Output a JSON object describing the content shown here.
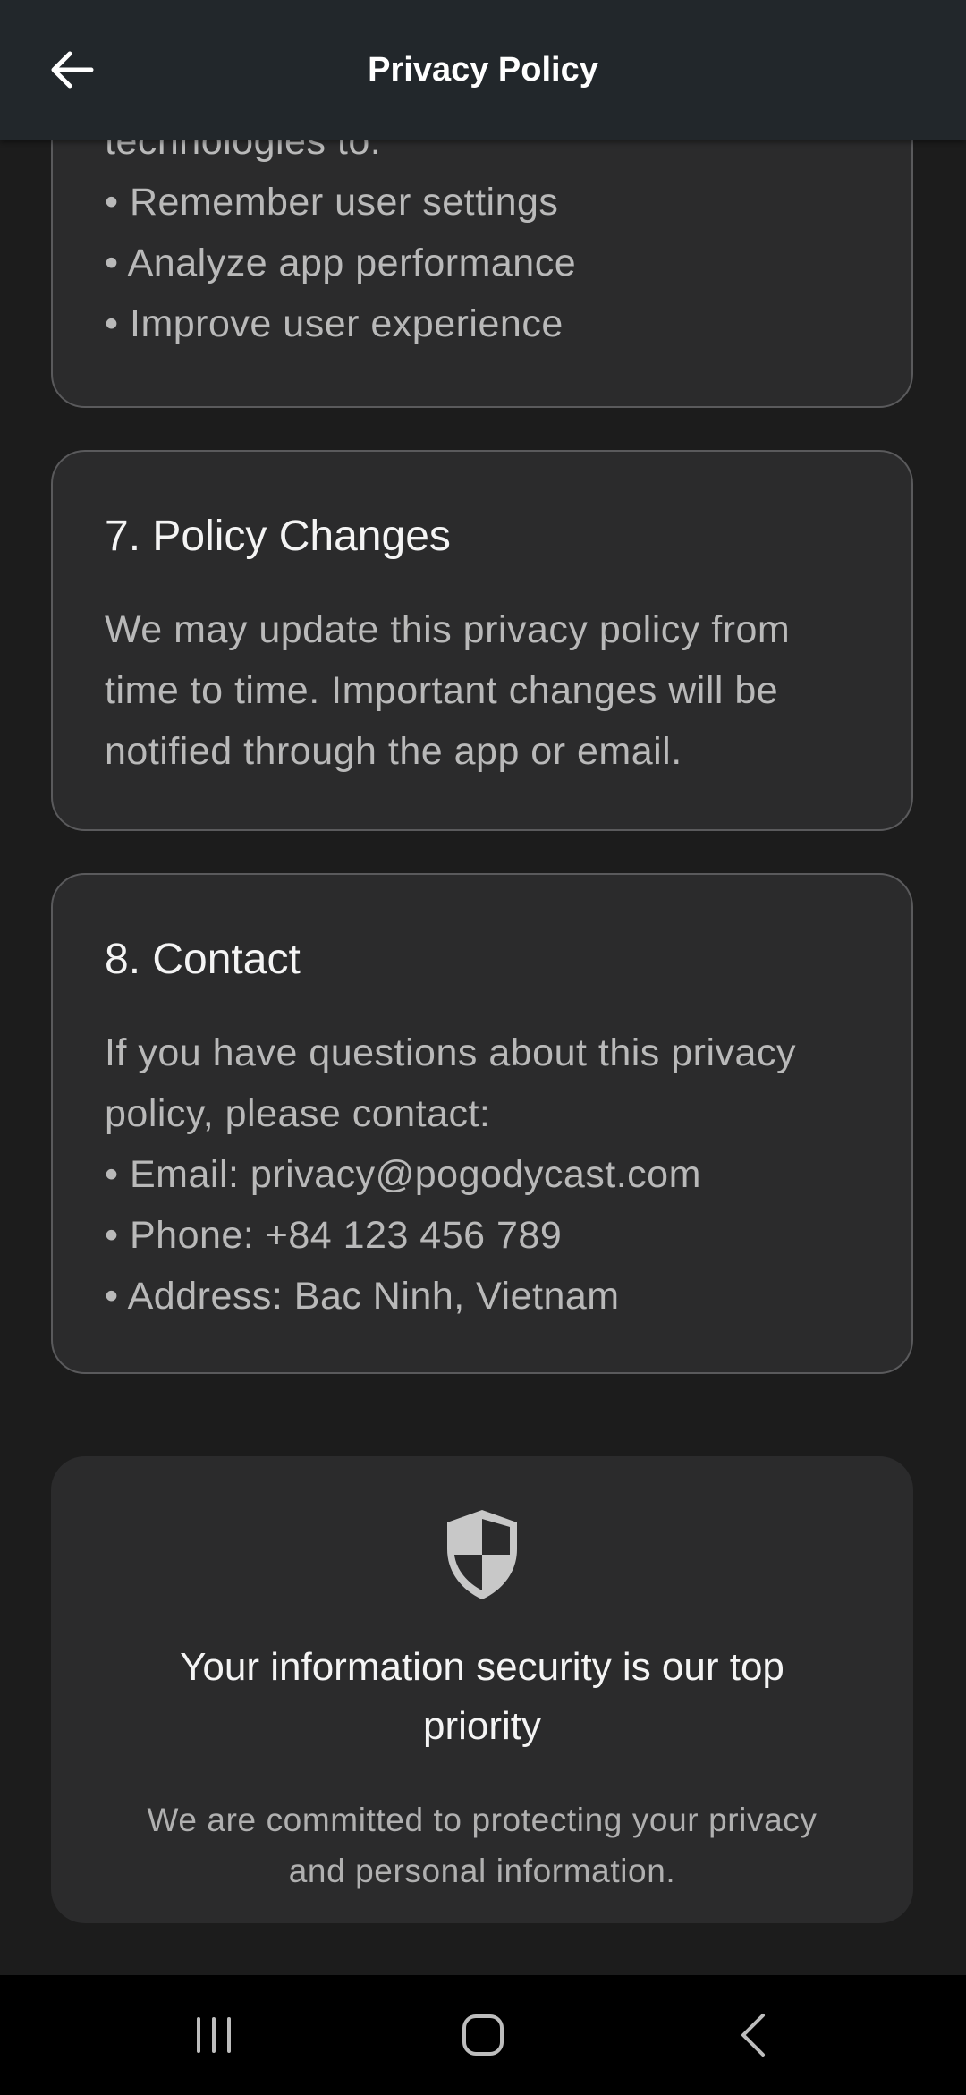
{
  "appbar": {
    "title": "Privacy Policy",
    "back_icon": "arrow-left-icon"
  },
  "sections": {
    "s6": {
      "partial_line": "technologies to:",
      "items": [
        "• Remember user settings",
        "• Analyze app performance",
        "• Improve user experience"
      ]
    },
    "s7": {
      "title": "7. Policy Changes",
      "lines": [
        "We may update this privacy policy from",
        "time to time. Important changes will be",
        "notified through the app or email."
      ]
    },
    "s8": {
      "title": "8. Contact",
      "lines": [
        "If you have questions about this privacy",
        "policy, please contact:",
        "• Email: privacy@pogodycast.com",
        "• Phone: +84 123 456 789",
        "• Address: Bac Ninh, Vietnam"
      ]
    }
  },
  "security": {
    "icon": "shield-icon",
    "title_lines": [
      "Your information security is our top",
      "priority"
    ],
    "subtitle_lines": [
      "We are committed to protecting your privacy",
      "and personal information."
    ]
  },
  "system_nav": {
    "recents_icon": "recents-icon",
    "home_icon": "home-icon",
    "back_icon": "system-back-icon"
  },
  "colors": {
    "background": "#1c1c1c",
    "card": "#2b2b2c",
    "appbar": "#22272b"
  }
}
